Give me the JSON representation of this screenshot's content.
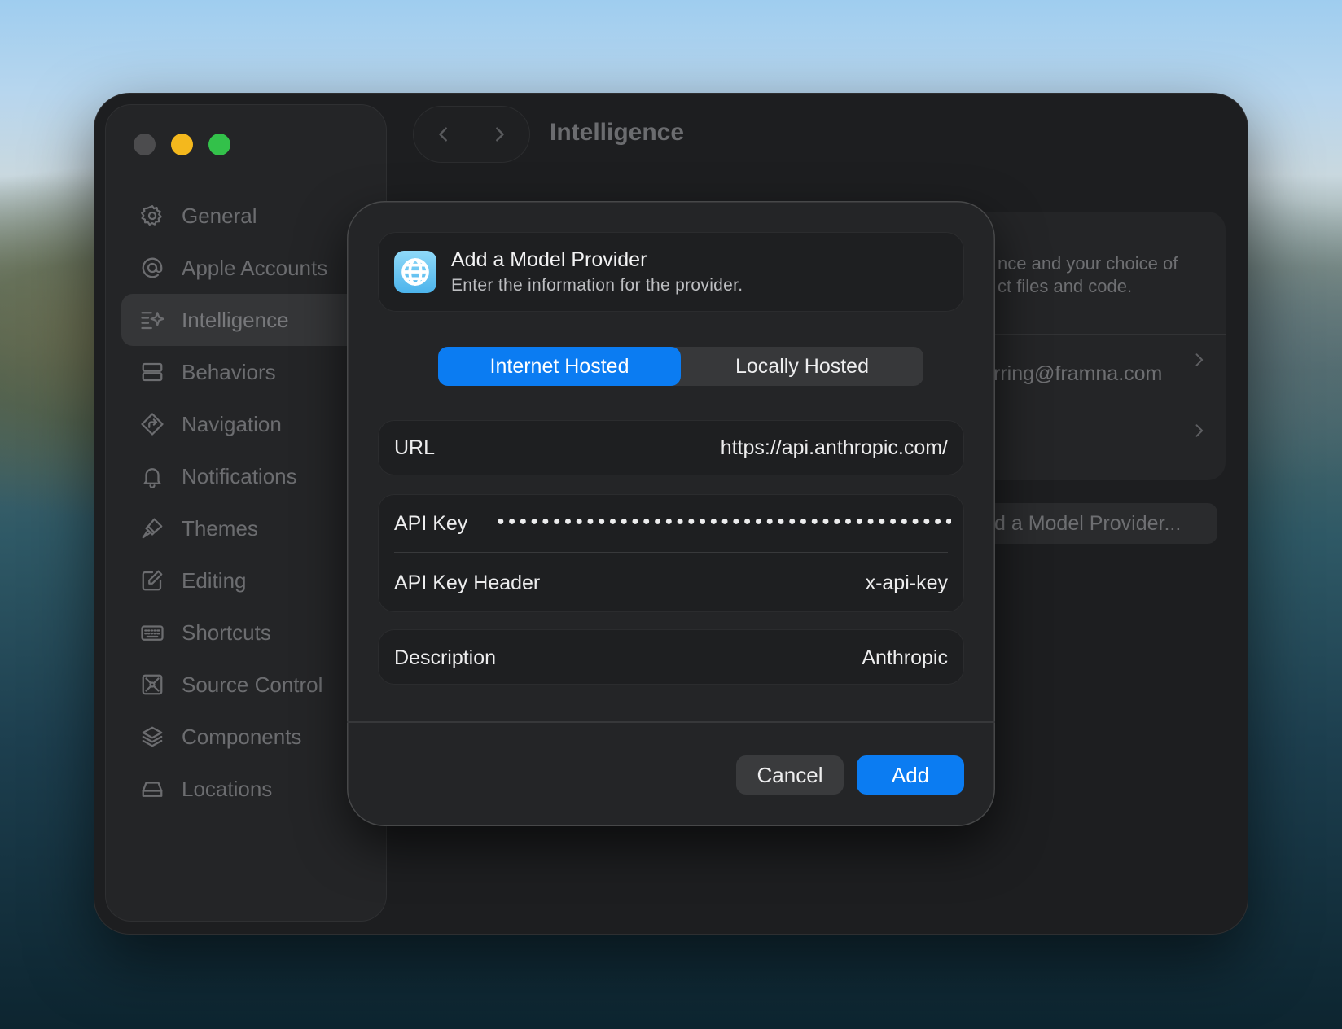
{
  "window": {
    "title": "Intelligence"
  },
  "sidebar": {
    "items": [
      {
        "label": "General",
        "icon": "gear-icon"
      },
      {
        "label": "Apple Accounts",
        "icon": "at-icon"
      },
      {
        "label": "Intelligence",
        "icon": "sparkle-lines-icon",
        "selected": true
      },
      {
        "label": "Behaviors",
        "icon": "stack-rect-icon"
      },
      {
        "label": "Navigation",
        "icon": "diamond-arrow-icon"
      },
      {
        "label": "Notifications",
        "icon": "bell-icon"
      },
      {
        "label": "Themes",
        "icon": "paintbrush-icon"
      },
      {
        "label": "Editing",
        "icon": "pencil-square-icon"
      },
      {
        "label": "Shortcuts",
        "icon": "keyboard-icon"
      },
      {
        "label": "Source Control",
        "icon": "source-control-icon"
      },
      {
        "label": "Components",
        "icon": "layers-icon"
      },
      {
        "label": "Locations",
        "icon": "drive-icon"
      }
    ]
  },
  "background_panel": {
    "description_line1": "nce and your choice of",
    "description_line2": "ct files and code.",
    "account_email": "rring@framna.com",
    "add_provider_button": "d a Model Provider..."
  },
  "dialog": {
    "icon": "globe-icon",
    "title": "Add a Model Provider",
    "subtitle": "Enter the information for the provider.",
    "segments": [
      "Internet Hosted",
      "Locally Hosted"
    ],
    "selected_segment": "Internet Hosted",
    "url_label": "URL",
    "url_value": "https://api.anthropic.com/",
    "api_key_label": "API Key",
    "api_key_value": "●●●●●●●●●●●●●●●●●●●●●●●●●●●●●●●●●●●●●●●●●●●●●●●",
    "api_key_header_label": "API Key Header",
    "api_key_header_value": "x-api-key",
    "description_label": "Description",
    "description_value": "Anthropic",
    "cancel_label": "Cancel",
    "add_label": "Add"
  },
  "colors": {
    "accent": "#0b7cf2",
    "traffic_close": "#4c4c4e",
    "traffic_minimize": "#f4b81d",
    "traffic_zoom": "#33c14a"
  }
}
